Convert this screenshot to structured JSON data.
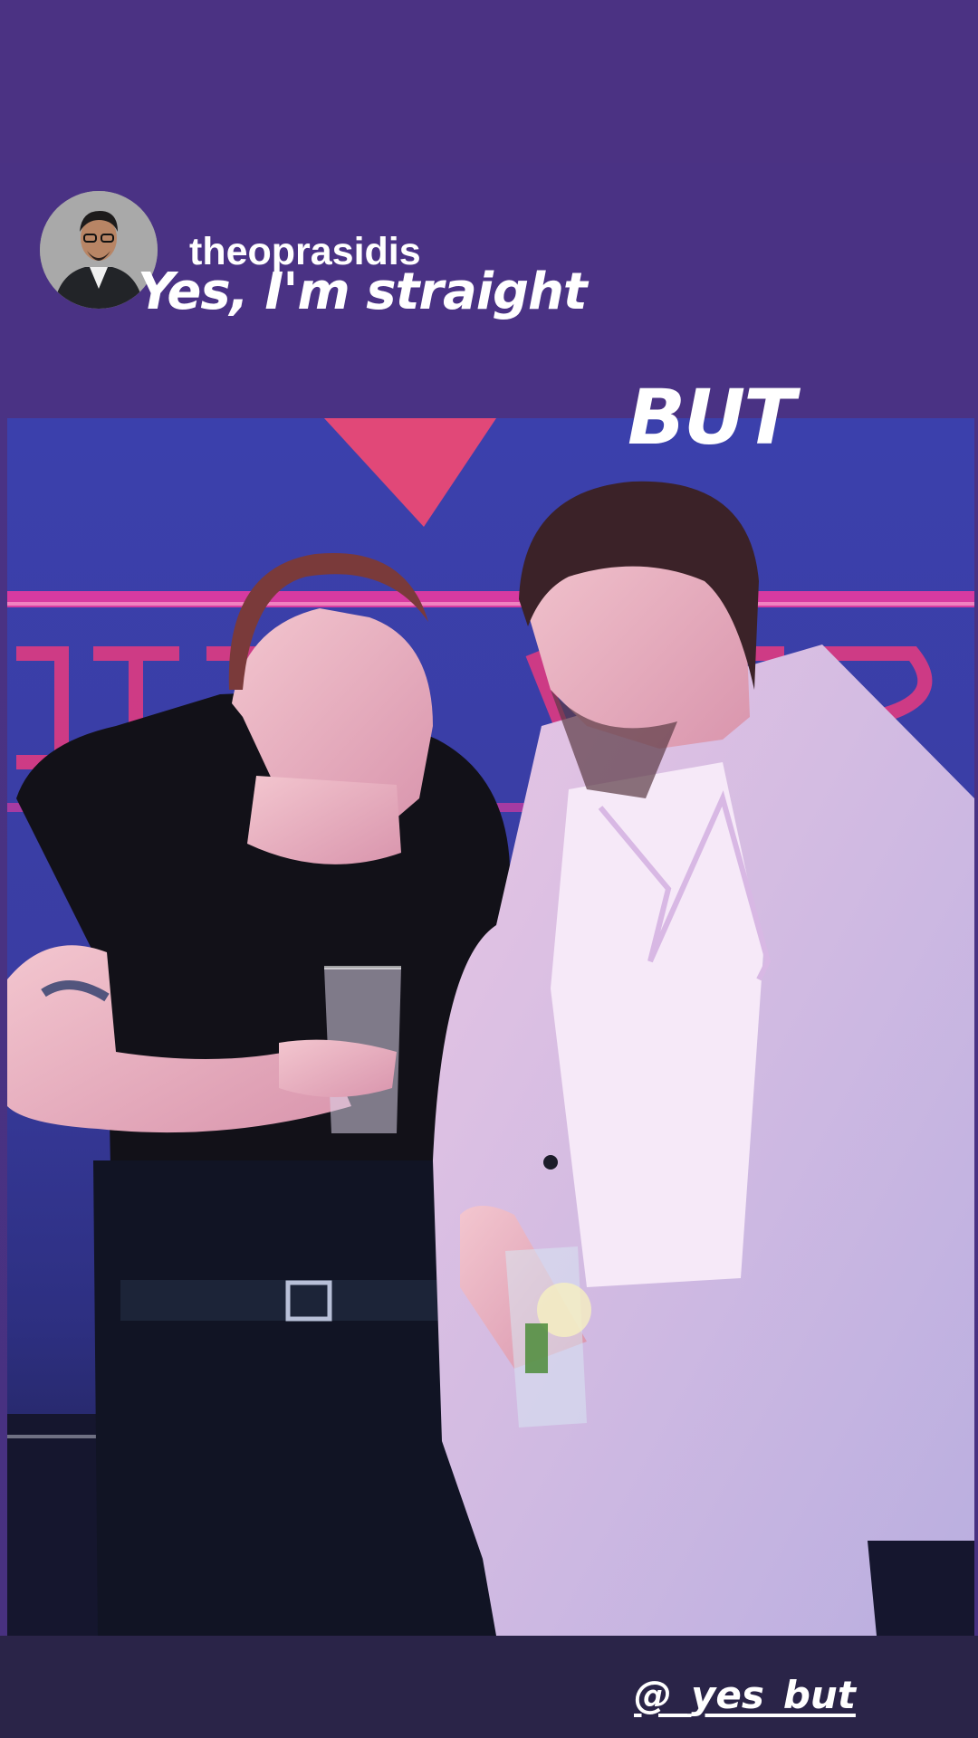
{
  "story": {
    "username": "theoprasidis",
    "caption_top": "Yes, I'm straight",
    "caption_middle": "BUT",
    "footer_handle": "@_yes_but"
  },
  "colors": {
    "background": "#4b3283",
    "text": "#ffffff",
    "neon": "#ff3a7a",
    "footer": "#2a2448"
  },
  "icons": {
    "avatar": "profile-avatar"
  }
}
